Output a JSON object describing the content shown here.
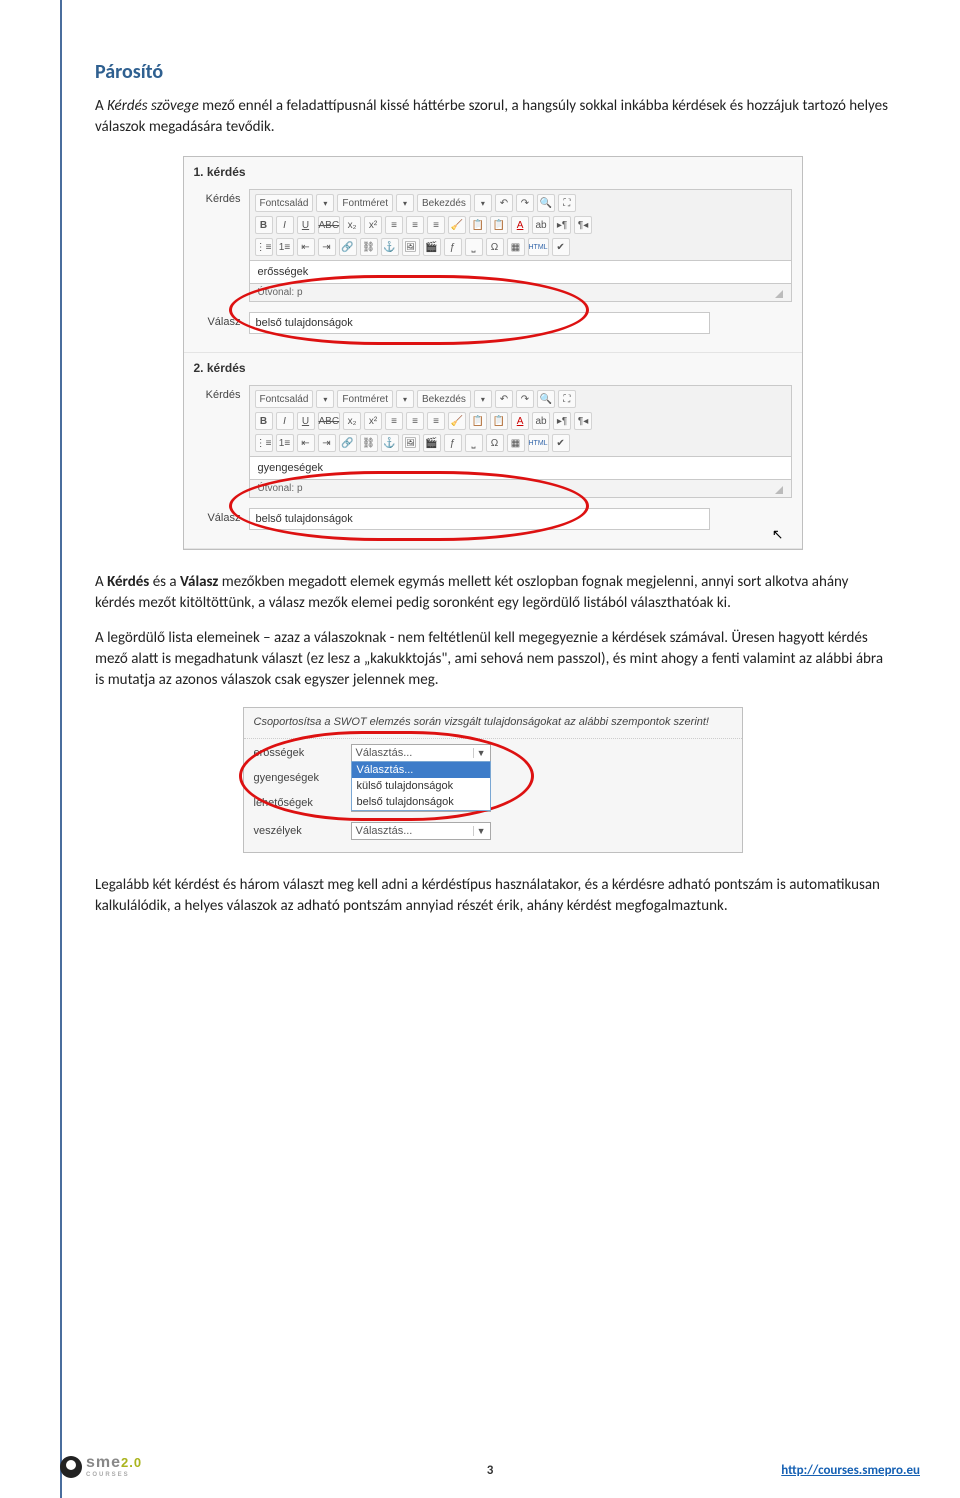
{
  "section_title": "Párosító",
  "para1_prefix": "A ",
  "para1_italic": "Kérdés szövege",
  "para1_rest": " mező ennél a feladattípusnál kissé háttérbe szorul, a hangsúly sokkal inkábba kérdések és hozzájuk tartozó helyes válaszok megadására tevődik.",
  "editor1": {
    "q1_head": "1. kérdés",
    "q2_head": "2. kérdés",
    "label_kerdes": "Kérdés",
    "label_valasz": "Válasz",
    "toolbar": {
      "fontfamily": "Fontcsalád",
      "fontsize": "Fontméret",
      "paragraph": "Bekezdés",
      "html_btn": "HTML"
    },
    "q1_content": "erősségek",
    "q1_path": "Útvonal: p",
    "q1_answer": "belső tulajdonságok",
    "q2_content": "gyengeségek",
    "q2_path": "Útvonal: p",
    "q2_answer": "belső tulajdonságok"
  },
  "para2_a": "A ",
  "para2_b1": "Kérdés",
  "para2_b2": " és a ",
  "para2_b3": "Válasz",
  "para2_rest": " mezőkben megadott elemek egymás mellett két oszlopban fognak megjelenni, annyi sort alkotva ahány kérdés mezőt kitöltöttünk, a válasz mezők elemei pedig soronként egy legördülő listából választhatóak ki.",
  "para3": "A legördülő lista elemeinek – azaz a válaszoknak - nem feltétlenül kell megegyeznie a kérdések számával. Üresen hagyott kérdés mező alatt is megadhatunk választ (ez lesz a „kakukktojás\", ami sehová nem passzol), és mint ahogy a fenti valamint az alábbi ábra is mutatja az azonos válaszok csak egyszer jelennek meg.",
  "swot": {
    "title": "Csoportosítsa a SWOT elemzés során vizsgált tulajdonságokat az alábbi szempontok szerint!",
    "row1_label": "erősségek",
    "row2_label": "gyengeségek",
    "row3_label": "lehetőségek",
    "row4_label": "veszélyek",
    "select_placeholder": "Választás...",
    "opt1": "Választás...",
    "opt2": "külső tulajdonságok",
    "opt3": "belső tulajdonságok"
  },
  "para4": "Legalább két kérdést és három választ meg kell adni a kérdéstípus használatakor, és a kérdésre adható pontszám is automatikusan kalkulálódik, a helyes válaszok az adható pontszám annyiad részét érik, ahány kérdést megfogalmaztunk.",
  "footer": {
    "page": "3",
    "url": "http://courses.smepro.eu",
    "logo_text": "sme",
    "logo_v": "2.0",
    "logo_sub": "COURSES"
  }
}
